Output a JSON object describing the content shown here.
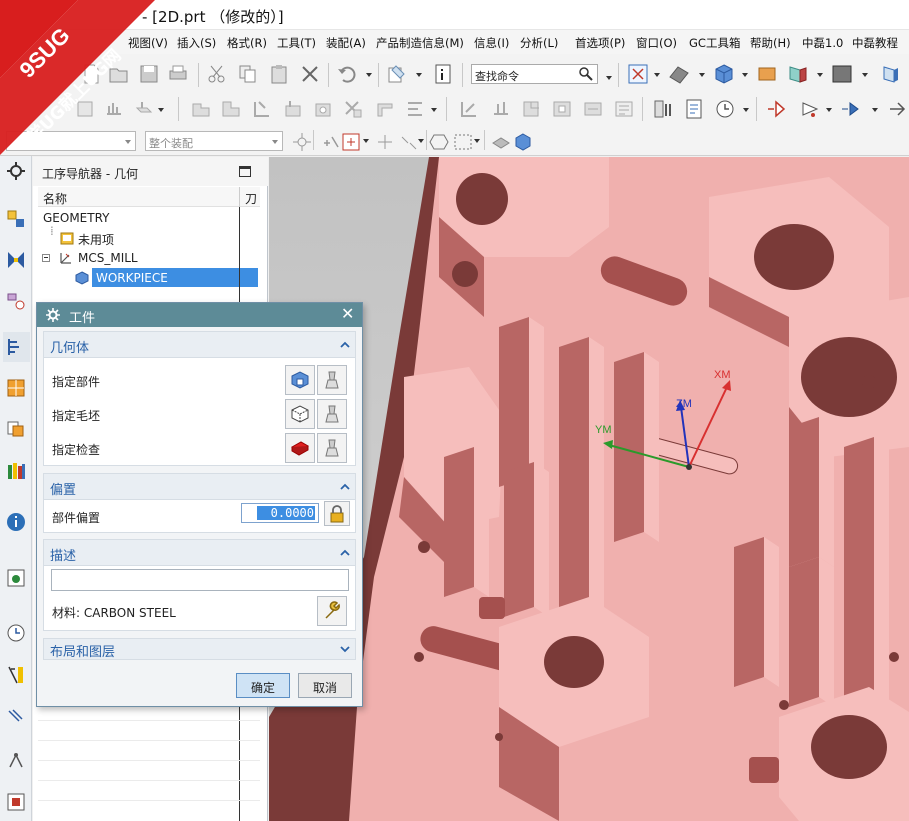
{
  "window": {
    "title": "- [2D.prt （修改的）]"
  },
  "watermark": {
    "line1": "9SUG",
    "line2": "学UG就上UG网"
  },
  "menubar": {
    "items": [
      "视图(V)",
      "插入(S)",
      "格式(R)",
      "工具(T)",
      "装配(A)",
      "产品制造信息(M)",
      "信息(I)",
      "分析(L)",
      "首选项(P)",
      "窗口(O)",
      "GC工具箱",
      "帮助(H)",
      "中磊1.0",
      "中磊教程"
    ]
  },
  "toolbar": {
    "search_placeholder": "查找命令",
    "filter_combo": "",
    "assembly_combo": "整个装配"
  },
  "navigator": {
    "title": "工序导航器 - 几何",
    "col_name": "名称",
    "col_tool": "刀",
    "rows": [
      "GEOMETRY",
      "未用项",
      "MCS_MILL",
      "WORKPIECE"
    ]
  },
  "dialog": {
    "title": "工件",
    "geometry": {
      "header": "几何体",
      "specify_part": "指定部件",
      "specify_blank": "指定毛坯",
      "specify_check": "指定检查"
    },
    "offset": {
      "header": "偏置",
      "part_offset_label": "部件偏置",
      "part_offset_value": "0.0000"
    },
    "description": {
      "header": "描述",
      "text": "",
      "material": "材料: CARBON STEEL"
    },
    "layout": {
      "header": "布局和图层"
    },
    "ok": "确定",
    "cancel": "取消"
  },
  "viewport": {
    "axes": {
      "x": "XM",
      "y": "YM",
      "z": "ZM"
    }
  },
  "colors": {
    "part_face": "#f0b0ae",
    "part_wall": "#c06e6c",
    "part_shadow": "#6d3331",
    "background": "#c6c6c6",
    "dialog_title": "#5d8b97",
    "selection": "#3d8ee2"
  }
}
